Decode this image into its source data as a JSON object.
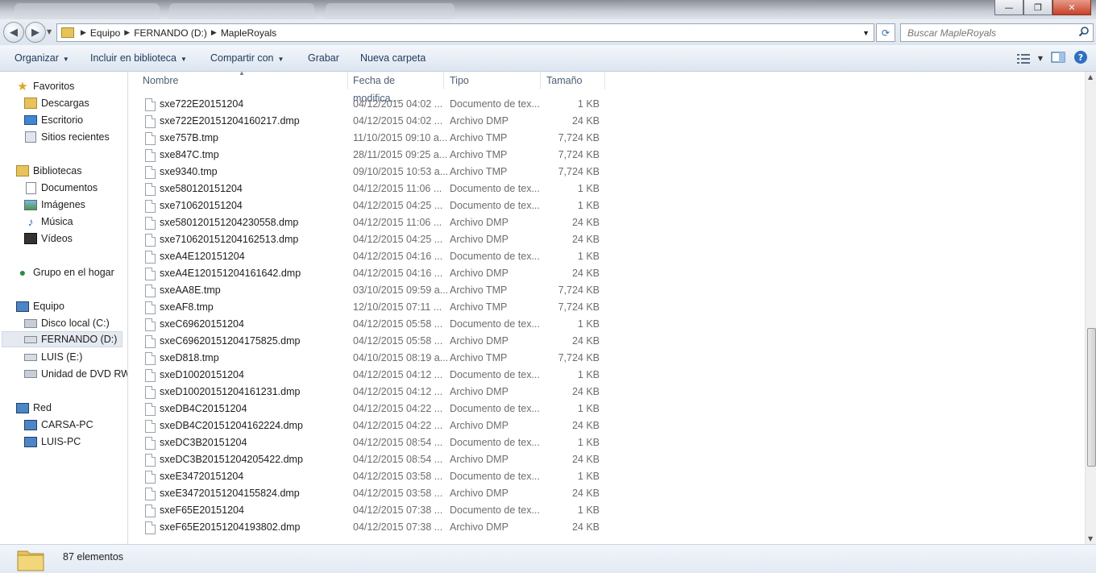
{
  "window": {
    "buttons": {
      "minimize": "—",
      "maximize": "❐",
      "close": "✕"
    }
  },
  "address": {
    "crumbs": [
      "Equipo",
      "FERNANDO (D:)",
      "MapleRoyals"
    ],
    "search_placeholder": "Buscar MapleRoyals"
  },
  "toolbar": {
    "organize": "Organizar",
    "include_library": "Incluir en biblioteca",
    "share_with": "Compartir con",
    "burn": "Grabar",
    "new_folder": "Nueva carpeta"
  },
  "nav": {
    "favorites": "Favoritos",
    "downloads": "Descargas",
    "desktop": "Escritorio",
    "recent": "Sitios recientes",
    "libraries": "Bibliotecas",
    "documents": "Documentos",
    "images": "Imágenes",
    "music": "Música",
    "videos": "Vídeos",
    "homegroup": "Grupo en el hogar",
    "computer": "Equipo",
    "disk_c": "Disco local (C:)",
    "disk_d": "FERNANDO (D:)",
    "disk_e": "LUIS (E:)",
    "dvd": "Unidad de DVD RW (",
    "network": "Red",
    "pc1": "CARSA-PC",
    "pc2": "LUIS-PC"
  },
  "columns": {
    "name": "Nombre",
    "date": "Fecha de modifica...",
    "type": "Tipo",
    "size": "Tamaño"
  },
  "files": [
    {
      "name": "sxe722E20151204",
      "date": "04/12/2015 04:02 ...",
      "type": "Documento de tex...",
      "size": "1 KB"
    },
    {
      "name": "sxe722E20151204160217.dmp",
      "date": "04/12/2015 04:02 ...",
      "type": "Archivo DMP",
      "size": "24 KB"
    },
    {
      "name": "sxe757B.tmp",
      "date": "11/10/2015 09:10 a...",
      "type": "Archivo TMP",
      "size": "7,724 KB"
    },
    {
      "name": "sxe847C.tmp",
      "date": "28/11/2015 09:25 a...",
      "type": "Archivo TMP",
      "size": "7,724 KB"
    },
    {
      "name": "sxe9340.tmp",
      "date": "09/10/2015 10:53 a...",
      "type": "Archivo TMP",
      "size": "7,724 KB"
    },
    {
      "name": "sxe580120151204",
      "date": "04/12/2015 11:06 ...",
      "type": "Documento de tex...",
      "size": "1 KB"
    },
    {
      "name": "sxe710620151204",
      "date": "04/12/2015 04:25 ...",
      "type": "Documento de tex...",
      "size": "1 KB"
    },
    {
      "name": "sxe580120151204230558.dmp",
      "date": "04/12/2015 11:06 ...",
      "type": "Archivo DMP",
      "size": "24 KB"
    },
    {
      "name": "sxe710620151204162513.dmp",
      "date": "04/12/2015 04:25 ...",
      "type": "Archivo DMP",
      "size": "24 KB"
    },
    {
      "name": "sxeA4E120151204",
      "date": "04/12/2015 04:16 ...",
      "type": "Documento de tex...",
      "size": "1 KB"
    },
    {
      "name": "sxeA4E120151204161642.dmp",
      "date": "04/12/2015 04:16 ...",
      "type": "Archivo DMP",
      "size": "24 KB"
    },
    {
      "name": "sxeAA8E.tmp",
      "date": "03/10/2015 09:59 a...",
      "type": "Archivo TMP",
      "size": "7,724 KB"
    },
    {
      "name": "sxeAF8.tmp",
      "date": "12/10/2015 07:11 ...",
      "type": "Archivo TMP",
      "size": "7,724 KB"
    },
    {
      "name": "sxeC69620151204",
      "date": "04/12/2015 05:58 ...",
      "type": "Documento de tex...",
      "size": "1 KB"
    },
    {
      "name": "sxeC69620151204175825.dmp",
      "date": "04/12/2015 05:58 ...",
      "type": "Archivo DMP",
      "size": "24 KB"
    },
    {
      "name": "sxeD818.tmp",
      "date": "04/10/2015 08:19 a...",
      "type": "Archivo TMP",
      "size": "7,724 KB"
    },
    {
      "name": "sxeD10020151204",
      "date": "04/12/2015 04:12 ...",
      "type": "Documento de tex...",
      "size": "1 KB"
    },
    {
      "name": "sxeD10020151204161231.dmp",
      "date": "04/12/2015 04:12 ...",
      "type": "Archivo DMP",
      "size": "24 KB"
    },
    {
      "name": "sxeDB4C20151204",
      "date": "04/12/2015 04:22 ...",
      "type": "Documento de tex...",
      "size": "1 KB"
    },
    {
      "name": "sxeDB4C20151204162224.dmp",
      "date": "04/12/2015 04:22 ...",
      "type": "Archivo DMP",
      "size": "24 KB"
    },
    {
      "name": "sxeDC3B20151204",
      "date": "04/12/2015 08:54 ...",
      "type": "Documento de tex...",
      "size": "1 KB"
    },
    {
      "name": "sxeDC3B20151204205422.dmp",
      "date": "04/12/2015 08:54 ...",
      "type": "Archivo DMP",
      "size": "24 KB"
    },
    {
      "name": "sxeE34720151204",
      "date": "04/12/2015 03:58 ...",
      "type": "Documento de tex...",
      "size": "1 KB"
    },
    {
      "name": "sxeE34720151204155824.dmp",
      "date": "04/12/2015 03:58 ...",
      "type": "Archivo DMP",
      "size": "24 KB"
    },
    {
      "name": "sxeF65E20151204",
      "date": "04/12/2015 07:38 ...",
      "type": "Documento de tex...",
      "size": "1 KB"
    },
    {
      "name": "sxeF65E20151204193802.dmp",
      "date": "04/12/2015 07:38 ...",
      "type": "Archivo DMP",
      "size": "24 KB"
    }
  ],
  "status": {
    "count": "87 elementos"
  }
}
